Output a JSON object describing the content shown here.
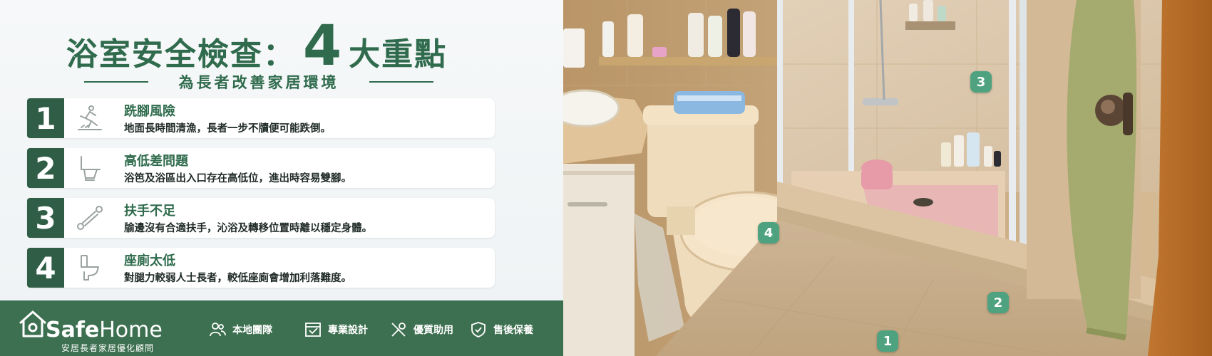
{
  "header": {
    "title_part1": "浴室安全檢查：",
    "title_number": "4",
    "title_part2": "大重點",
    "subtitle": "為長者改善家居環境"
  },
  "items": [
    {
      "number": "1",
      "title": "跣腳風險",
      "description": "地面長時間清漁，長者一步不牘便可能跌倒。",
      "icon": "slip-person-icon"
    },
    {
      "number": "2",
      "title": "高低差問題",
      "description": "浴笆及浴區出入口存在高低位，進出時容易雙腳。",
      "icon": "toilet-side-icon"
    },
    {
      "number": "3",
      "title": "扶手不足",
      "description": "牏邊沒有合適扶手，沁浴及轉移位置時離以穩定身體。",
      "icon": "grab-bar-icon"
    },
    {
      "number": "4",
      "title": "座廁太低",
      "description": "對腿力較弱人士長者，較低座廁會增加利落難度。",
      "icon": "toilet-icon"
    }
  ],
  "footer": {
    "brand_part1": "Safe",
    "brand_part2": "Home",
    "tagline": "安居長者家居優化顧問",
    "features": [
      {
        "label": "本地團隊",
        "icon": "team-icon"
      },
      {
        "label": "專業設計",
        "icon": "design-icon"
      },
      {
        "label": "優質助用",
        "icon": "tools-icon"
      },
      {
        "label": "售後保養",
        "icon": "shield-icon"
      }
    ]
  },
  "photo_markers": [
    "1",
    "2",
    "3",
    "4"
  ],
  "colors": {
    "primary_green": "#2f6b4c",
    "footer_green": "#3d7050",
    "marker_green": "#4fa27f"
  }
}
